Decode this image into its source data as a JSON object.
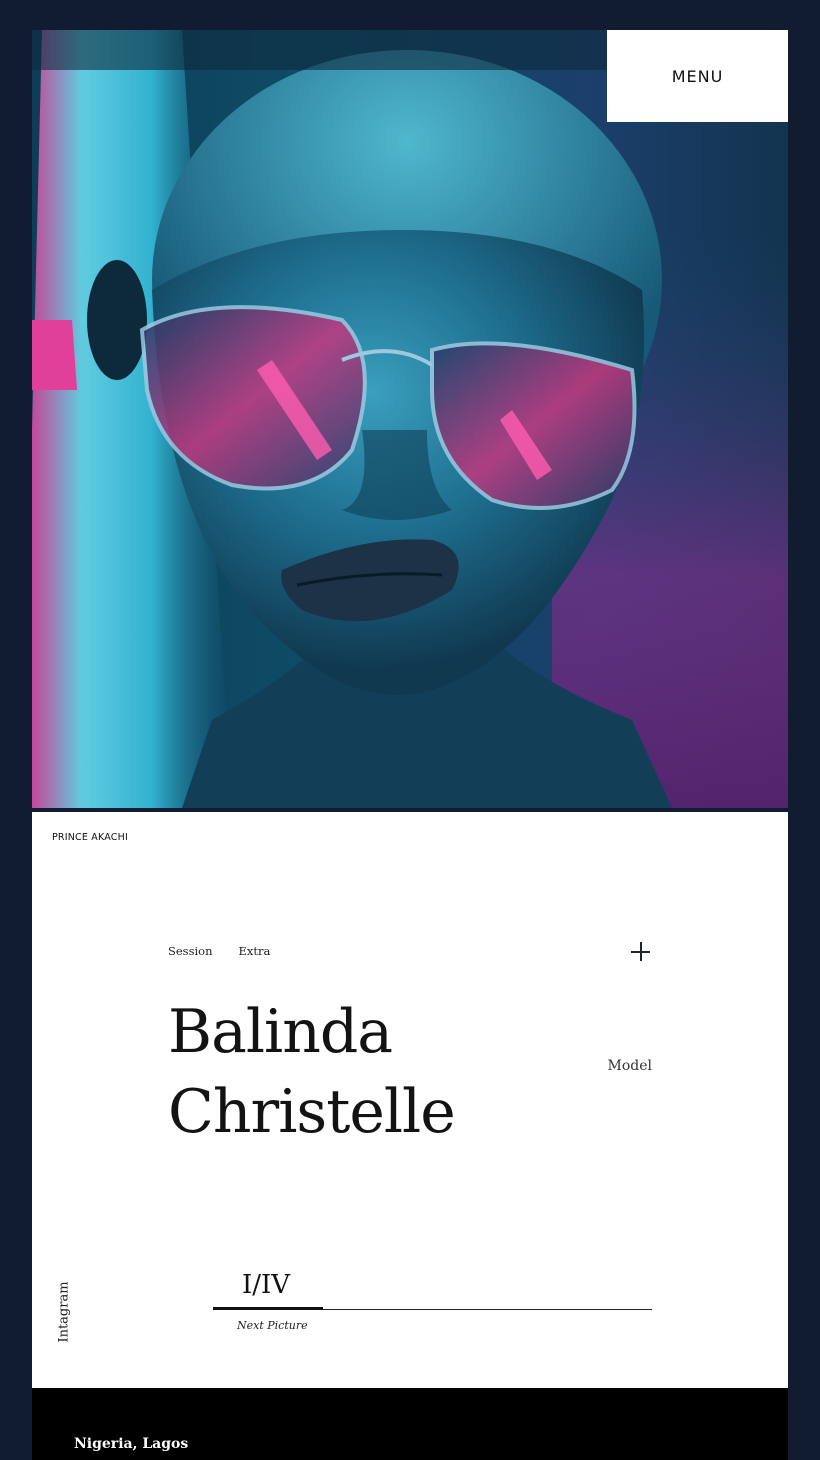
{
  "header": {
    "menu_label": "MENU"
  },
  "hero": {
    "image_name": "portrait-neon-glasses"
  },
  "card": {
    "brand": "PRINCE AKACHI",
    "tabs": [
      {
        "label": "Session"
      },
      {
        "label": "Extra"
      }
    ],
    "plus_icon": "plus-icon",
    "name_line1": "Balinda",
    "name_line2": "Christelle",
    "role": "Model",
    "social_label": "Intagram",
    "counter": "I/IV",
    "next_label": "Next Picture",
    "progress_fraction": 0.25
  },
  "footer": {
    "location": "Nigeria, Lagos"
  },
  "colors": {
    "page_bg": "#121c30",
    "card_bg": "#ffffff",
    "footer_bg": "#000000",
    "neon_cyan": "#3fd3ef",
    "neon_magenta": "#e0409a"
  }
}
